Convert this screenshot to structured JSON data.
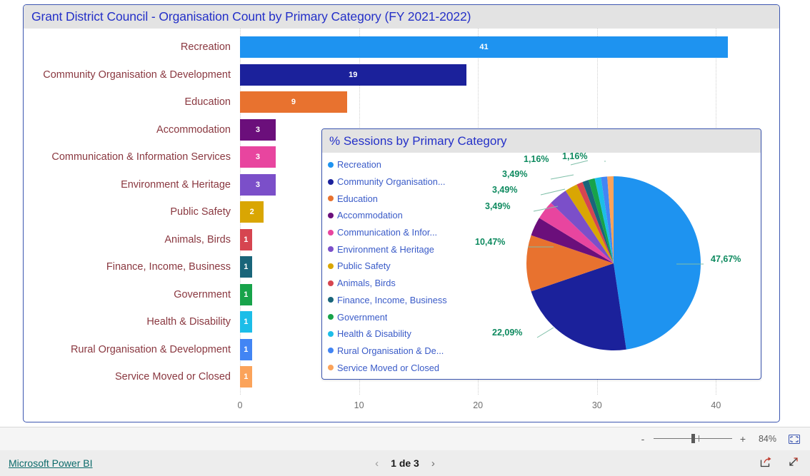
{
  "bar_visual": {
    "title": "Grant District Council - Organisation Count by Primary Category (FY 2021-2022)"
  },
  "pie_visual": {
    "title": "% Sessions by Primary Category"
  },
  "toolbar": {
    "zoom_out_label": "-",
    "zoom_in_label": "+",
    "zoom_percent": "84%",
    "fit_to_page_icon": "fit-page-icon"
  },
  "footer": {
    "brand_link": "Microsoft Power BI",
    "prev_icon": "‹",
    "next_icon": "›",
    "page_label": "1 de 3",
    "share_icon": "share-icon",
    "fullscreen_icon": "fullscreen-icon"
  },
  "chart_data": [
    {
      "type": "bar",
      "orientation": "horizontal",
      "title": "Grant District Council - Organisation Count by Primary Category (FY 2021-2022)",
      "xlabel": "",
      "ylabel": "",
      "xlim": [
        0,
        44
      ],
      "grid": true,
      "xticks": [
        "0",
        "10",
        "20",
        "30",
        "40"
      ],
      "categories": [
        "Recreation",
        "Community Organisation & Development",
        "Education",
        "Accommodation",
        "Communication & Information Services",
        "Environment & Heritage",
        "Public Safety",
        "Animals, Birds",
        "Finance, Income, Business",
        "Government",
        "Health & Disability",
        "Rural Organisation & Development",
        "Service Moved or Closed"
      ],
      "values": [
        41,
        19,
        9,
        3,
        3,
        3,
        2,
        1,
        1,
        1,
        1,
        1,
        1
      ],
      "colors": [
        "#1E93F0",
        "#1B219B",
        "#E8722F",
        "#6B0F7B",
        "#E8459F",
        "#7B4FC9",
        "#D9A603",
        "#D64550",
        "#19657A",
        "#17A34A",
        "#1CBDE8",
        "#4285F4",
        "#FBA35A"
      ]
    },
    {
      "type": "pie",
      "title": "% Sessions by Primary Category",
      "legend_position": "left",
      "labels": [
        "Recreation",
        "Community Organisation...",
        "Education",
        "Accommodation",
        "Communication & Infor...",
        "Environment & Heritage",
        "Public Safety",
        "Animals, Birds",
        "Finance, Income, Business",
        "Government",
        "Health & Disability",
        "Rural Organisation & De...",
        "Service Moved or Closed"
      ],
      "values": [
        47.67,
        22.09,
        10.47,
        3.49,
        3.49,
        3.49,
        2.33,
        1.16,
        1.16,
        1.16,
        1.16,
        1.16,
        1.16
      ],
      "value_labels": [
        "47,67%",
        "22,09%",
        "10,47%",
        "3,49%",
        "3,49%",
        "3,49%",
        "",
        "1,16%",
        "",
        "1,16%",
        "",
        "",
        ""
      ],
      "visible_value_labels": [
        "47,67%",
        "22,09%",
        "10,47%",
        "3,49%",
        "3,49%",
        "3,49%",
        "1,16%",
        "1,16%"
      ],
      "colors": [
        "#1E93F0",
        "#1B219B",
        "#E8722F",
        "#6B0F7B",
        "#E8459F",
        "#7B4FC9",
        "#D9A603",
        "#D64550",
        "#19657A",
        "#17A34A",
        "#1CBDE8",
        "#4285F4",
        "#FBA35A"
      ],
      "label_color": "#0E8A5F"
    }
  ]
}
